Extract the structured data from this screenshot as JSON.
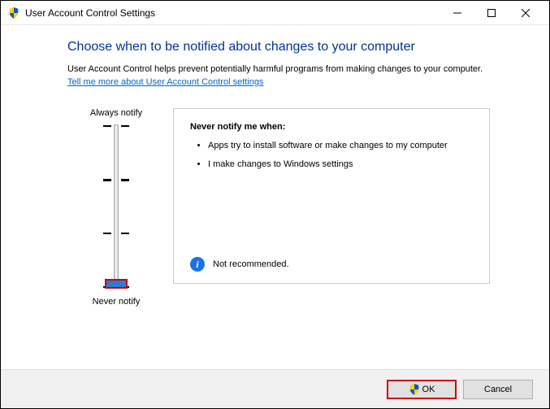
{
  "window": {
    "title": "User Account Control Settings"
  },
  "heading": "Choose when to be notified about changes to your computer",
  "description": "User Account Control helps prevent potentially harmful programs from making changes to your computer.",
  "link": "Tell me more about User Account Control settings",
  "slider": {
    "topLabel": "Always notify",
    "bottomLabel": "Never notify"
  },
  "infobox": {
    "title": "Never notify me when:",
    "bullet1": "Apps try to install software or make changes to my computer",
    "bullet2": "I make changes to Windows settings",
    "status": "Not recommended."
  },
  "buttons": {
    "ok": "OK",
    "cancel": "Cancel"
  }
}
